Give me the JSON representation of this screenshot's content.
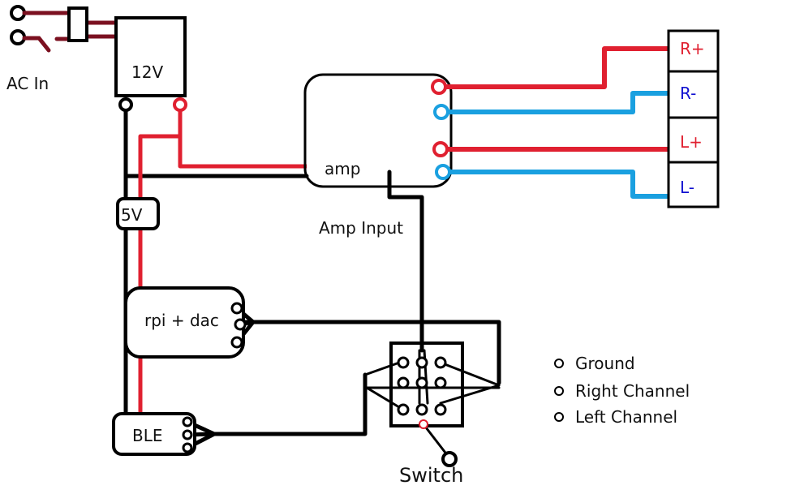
{
  "colors": {
    "ac_wire": "#7b1020",
    "positive": "#e02030",
    "negative": "#1aa0e0",
    "ground": "#000000",
    "red_label": "#e02030",
    "blue_label": "#1010d0"
  },
  "components": {
    "ac_in": "AC In",
    "psu_12v": "12V",
    "regulator_5v": "5V",
    "amp": "amp",
    "amp_input": "Amp Input",
    "rpi": "rpi + dac",
    "ble": "BLE",
    "switch": "Switch"
  },
  "speaker_terminals": [
    {
      "label": "R+",
      "color": "#e02030"
    },
    {
      "label": "R-",
      "color": "#1010d0"
    },
    {
      "label": "L+",
      "color": "#e02030"
    },
    {
      "label": "L-",
      "color": "#1010d0"
    }
  ],
  "legend": [
    "Ground",
    "Right Channel",
    "Left Channel"
  ]
}
